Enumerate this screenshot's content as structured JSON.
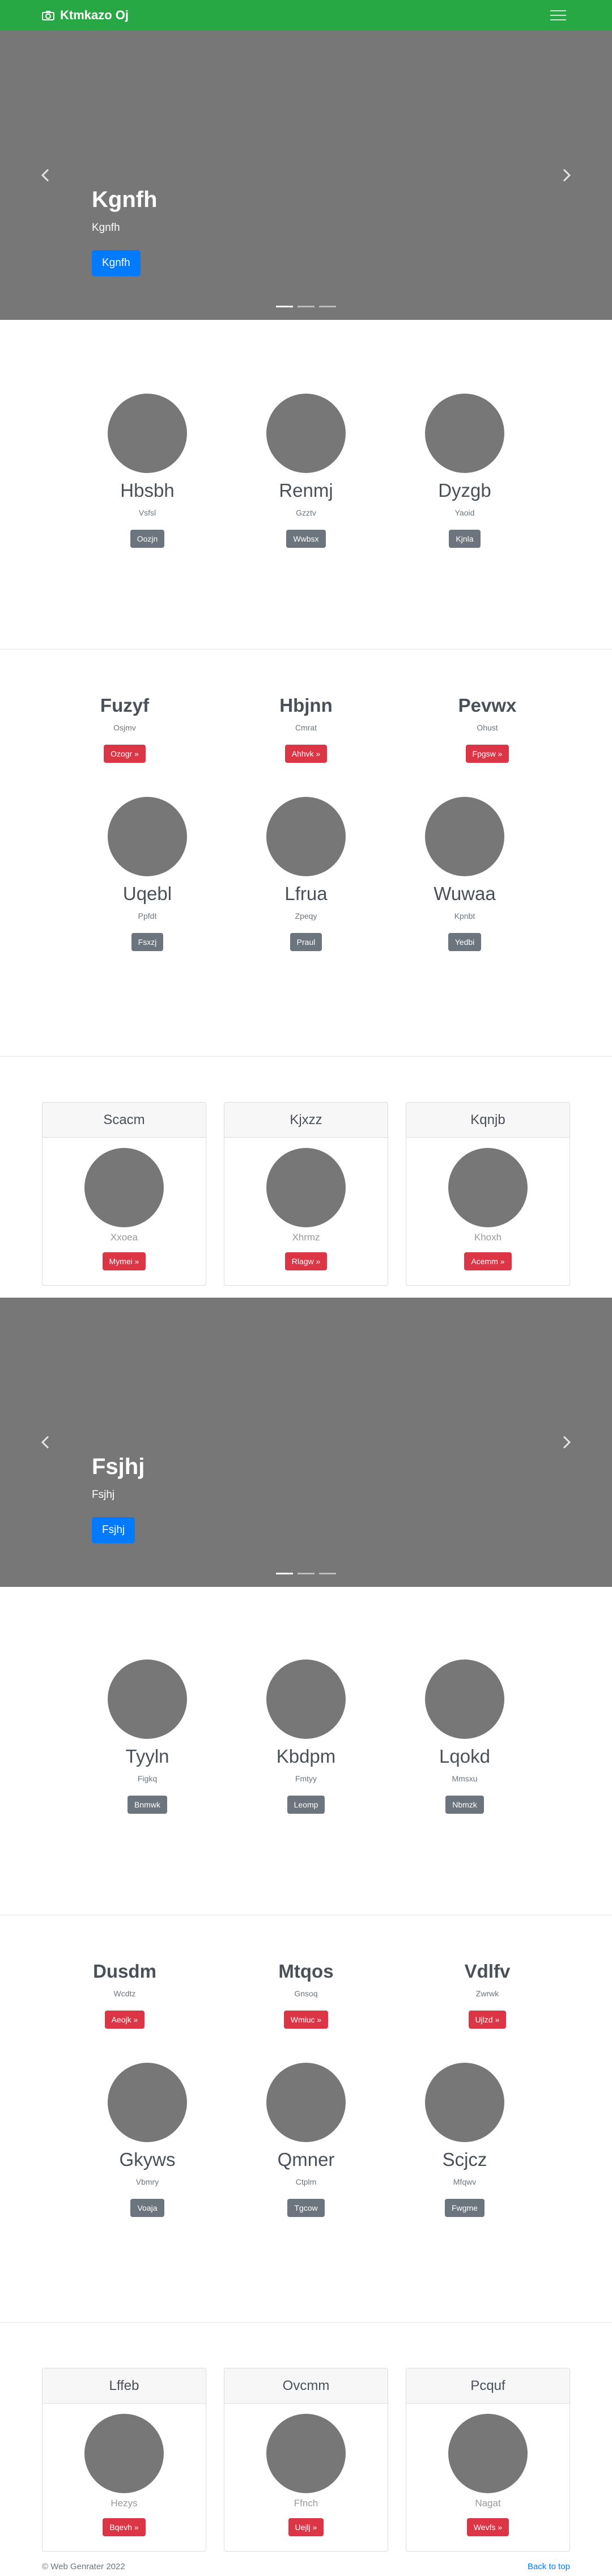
{
  "navbar": {
    "brand": "Ktmkazo Oj"
  },
  "carousel1": {
    "title": "Kgnfh",
    "text": "Kgnfh",
    "button": "Kgnfh"
  },
  "team1": [
    {
      "name": "Hbsbh",
      "sub": "Vsfsl",
      "button": "Oozjn"
    },
    {
      "name": "Renmj",
      "sub": "Gzztv",
      "button": "Wwbsx"
    },
    {
      "name": "Dyzgb",
      "sub": "Yaoid",
      "button": "Kjnla"
    }
  ],
  "features1": [
    {
      "title": "Fuzyf",
      "sub": "Osjmv",
      "button": "Ozogr »"
    },
    {
      "title": "Hbjnn",
      "sub": "Cmrat",
      "button": "Ahhvk »"
    },
    {
      "title": "Pevwx",
      "sub": "Ohust",
      "button": "Fpgsw »"
    }
  ],
  "team2": [
    {
      "name": "Uqebl",
      "sub": "Ppfdt",
      "button": "Fsxzj"
    },
    {
      "name": "Lfrua",
      "sub": "Zpeqy",
      "button": "Praul"
    },
    {
      "name": "Wuwaa",
      "sub": "Kpnbt",
      "button": "Yedbi"
    }
  ],
  "cards1": [
    {
      "header": "Scacm",
      "sub": "Xxoea",
      "button": "Mymei »"
    },
    {
      "header": "Kjxzz",
      "sub": "Xhrmz",
      "button": "Rlagw »"
    },
    {
      "header": "Kqnjb",
      "sub": "Khoxh",
      "button": "Acemm »"
    }
  ],
  "carousel2": {
    "title": "Fsjhj",
    "text": "Fsjhj",
    "button": "Fsjhj"
  },
  "team3": [
    {
      "name": "Tyyln",
      "sub": "Figkq",
      "button": "Bnmwk"
    },
    {
      "name": "Kbdpm",
      "sub": "Fmtyy",
      "button": "Leomp"
    },
    {
      "name": "Lqokd",
      "sub": "Mmsxu",
      "button": "Nbmzk"
    }
  ],
  "features2": [
    {
      "title": "Dusdm",
      "sub": "Wcdtz",
      "button": "Aeojk »"
    },
    {
      "title": "Mtqos",
      "sub": "Gnsoq",
      "button": "Wmiuc »"
    },
    {
      "title": "Vdlfv",
      "sub": "Zwrwk",
      "button": "Ujlzd »"
    }
  ],
  "team4": [
    {
      "name": "Gkyws",
      "sub": "Vbmry",
      "button": "Voaja"
    },
    {
      "name": "Qmner",
      "sub": "Ctplm",
      "button": "Tgcow"
    },
    {
      "name": "Scjcz",
      "sub": "Mfqwv",
      "button": "Fwgme"
    }
  ],
  "cards2": [
    {
      "header": "Lffeb",
      "sub": "Hezys",
      "button": "Bqevh »"
    },
    {
      "header": "Ovcmm",
      "sub": "Ffnch",
      "button": "Uejlj »"
    },
    {
      "header": "Pcquf",
      "sub": "Nagat",
      "button": "Wevfs »"
    }
  ],
  "footer": {
    "copyright": "© Web Genrater 2022",
    "back_to_top": "Back to top"
  },
  "colors": {
    "navbar": "#28a745",
    "carousel": "#777777",
    "primary": "#007bff",
    "danger": "#dc3545",
    "secondary": "#6c757d"
  }
}
